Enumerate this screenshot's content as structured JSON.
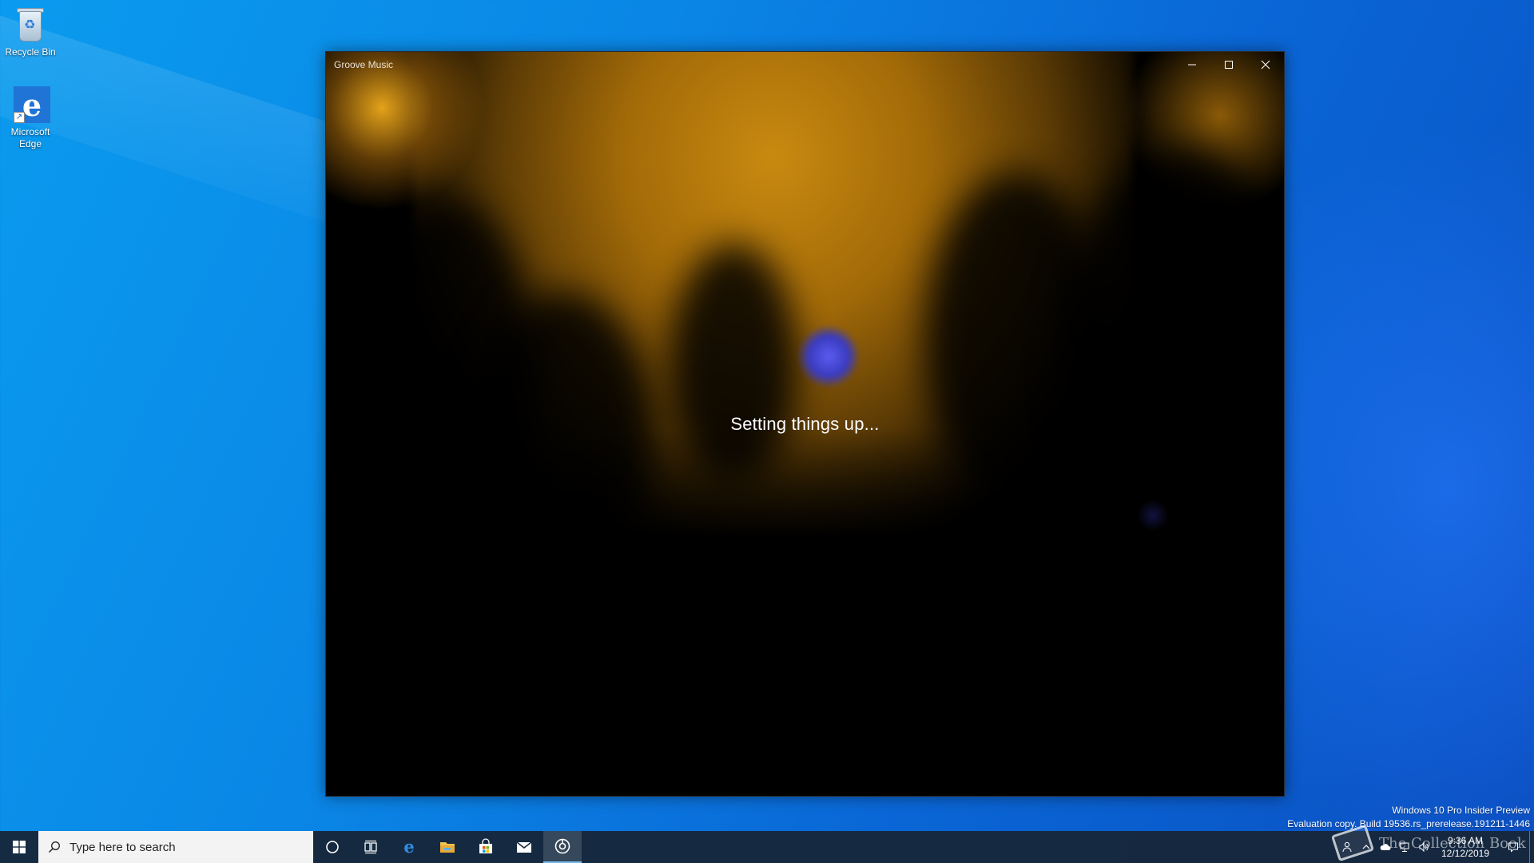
{
  "desktop": {
    "icons": [
      {
        "label": "Recycle Bin",
        "icon": "recycle-bin-icon"
      },
      {
        "label": "Microsoft Edge",
        "icon": "edge-icon"
      }
    ]
  },
  "window": {
    "title": "Groove Music",
    "status": "Setting things up...",
    "caption": {
      "minimize": "minimize-icon",
      "maximize": "maximize-icon",
      "close": "close-icon"
    }
  },
  "watermark": {
    "line1": "Windows 10 Pro Insider Preview",
    "line2": "Evaluation copy. Build 19536.rs_prerelease.191211-1446"
  },
  "taskbar": {
    "search_placeholder": "Type here to search",
    "apps": [
      "cortana-icon",
      "task-view-icon",
      "edge-icon",
      "file-explorer-icon",
      "store-icon",
      "mail-icon",
      "groove-music-icon"
    ],
    "clock_time": "9:36 AM",
    "clock_date": "12/12/2019"
  },
  "overlay_logo": "The Collection Book",
  "colors": {
    "desktop_blue": "#0a86e6",
    "taskbar": "#16263a",
    "accent_gold": "#c98a10"
  }
}
